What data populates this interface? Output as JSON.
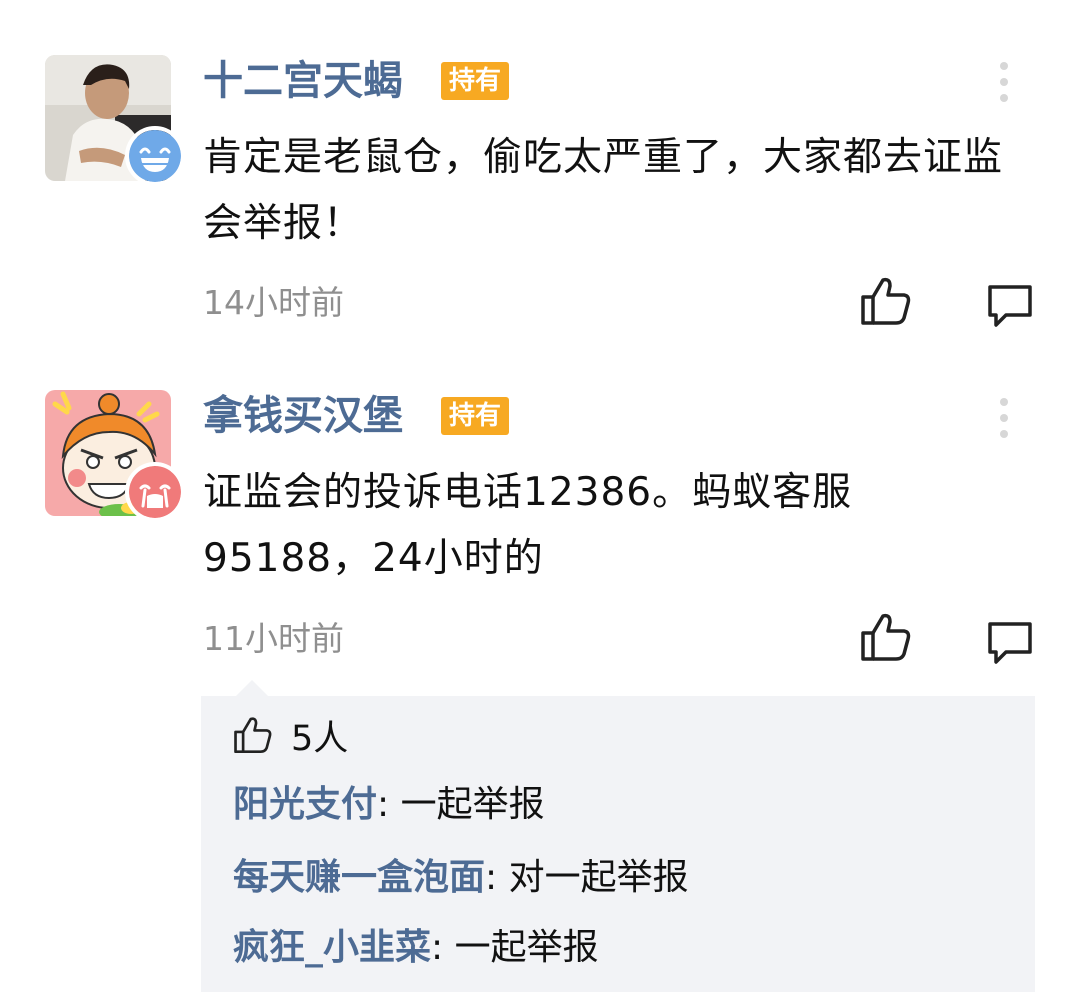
{
  "comments": [
    {
      "username": "十二宫天蝎",
      "badge": "持有",
      "content": "肯定是老鼠仓，偷吃太严重了，大家都去证监会举报！",
      "time": "14小时前",
      "avatar_icon": "man-photo-avatar",
      "emoji_icon": "grinning-emoji-badge",
      "emoji_color": "#6fa9e8"
    },
    {
      "username": "拿钱买汉堡",
      "badge": "持有",
      "content": "证监会的投诉电话12386。蚂蚁客服95188，24小时的",
      "time": "11小时前",
      "avatar_icon": "cartoon-girl-avatar",
      "emoji_icon": "crying-emoji-badge",
      "emoji_color": "#f07a7a"
    }
  ],
  "reply_panel": {
    "likes_count": "5人",
    "replies": [
      {
        "user": "阳光支付",
        "separator": ":",
        "text": "一起举报"
      },
      {
        "user": "每天赚一盒泡面",
        "separator": ":",
        "text": "对一起举报"
      },
      {
        "user": "疯狂_小韭菜",
        "separator": ":",
        "text": "一起举报"
      }
    ]
  },
  "colors": {
    "username": "#4d6b94",
    "badge": "#f7a922",
    "time": "#8f8f8f",
    "panel_bg": "#f2f3f6"
  }
}
